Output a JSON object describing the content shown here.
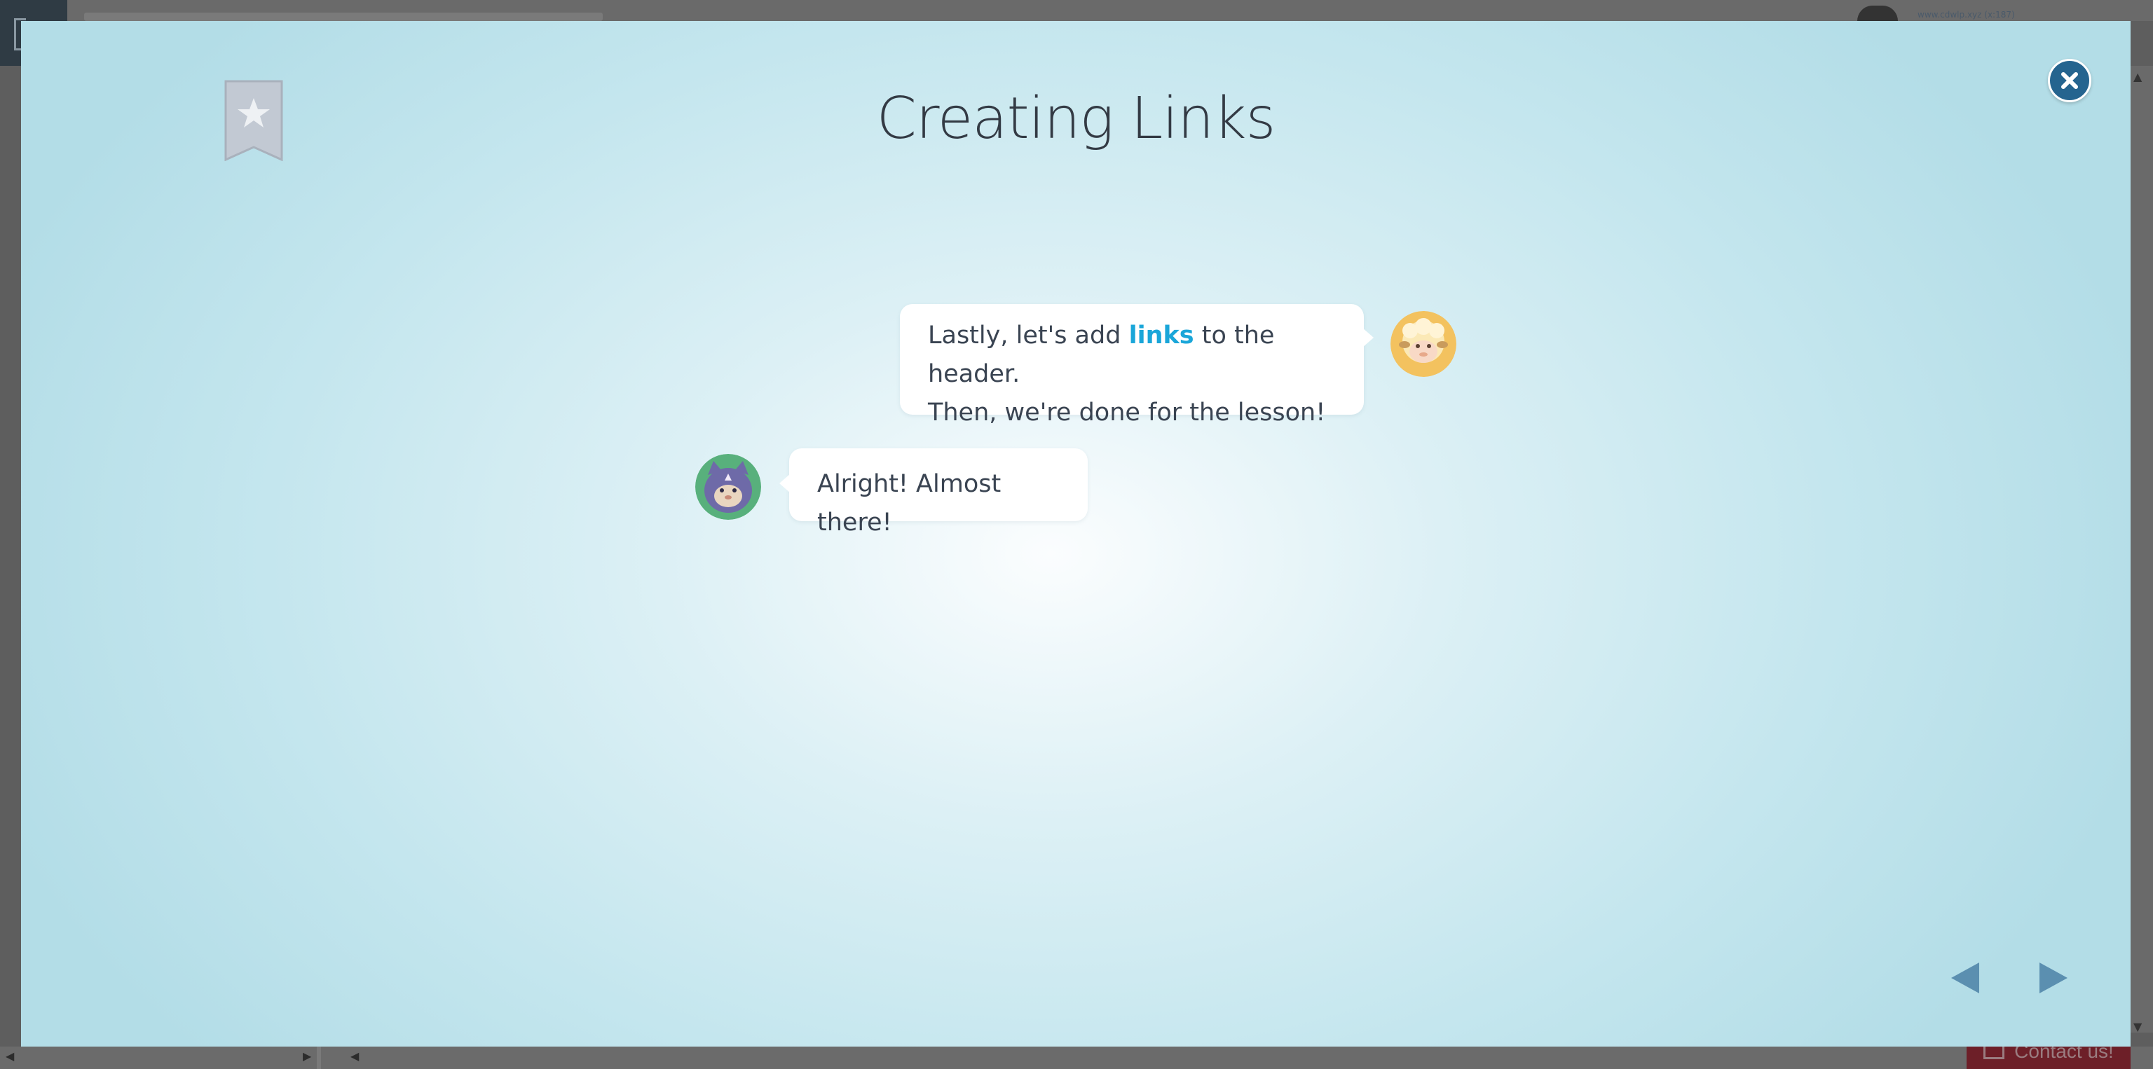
{
  "background_app": {
    "username": "www.cdwlp.xyz (x:187)",
    "contact_button_label": "Contact us!"
  },
  "lesson": {
    "title": "Creating Links",
    "bookmark_icon": "star-bookmark-icon",
    "close_icon": "close-icon"
  },
  "dialogue": [
    {
      "speaker": "mentor",
      "avatar_icon": "sheep-avatar",
      "text_line1_before": "Lastly, let's add",
      "text_highlight": "links",
      "text_line1_after": "to the header.",
      "text_line2": "Then, we're done for the lesson!"
    },
    {
      "speaker": "student",
      "avatar_icon": "cat-avatar",
      "text": "Alright! Almost there!"
    }
  ],
  "navigation": {
    "prev_icon": "triangle-left-icon",
    "next_icon": "triangle-right-icon"
  },
  "colors": {
    "accent": "#1aa6d9",
    "close_bg": "#25648f",
    "nav_arrow": "#5b8fb0",
    "bookmark": "#c0c7d1"
  }
}
